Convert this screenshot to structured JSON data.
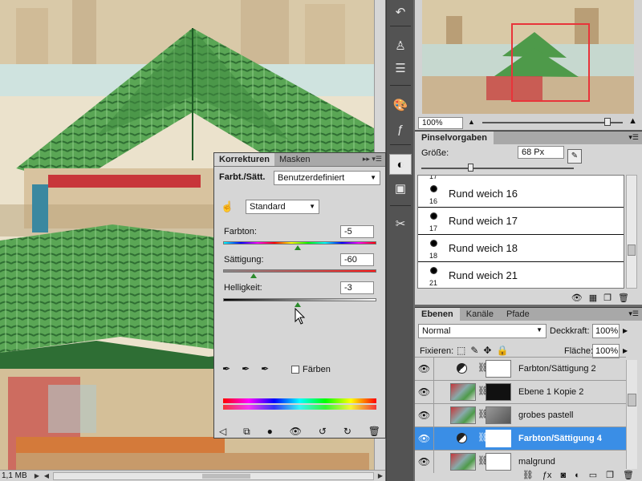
{
  "colors": {
    "accent": "#3a8ee6",
    "roof_green": "#4e9a4a",
    "red_accent": "#c8363a",
    "panel_bg": "#d6d6d6"
  },
  "status_bar": {
    "zoom_value": "1,1 MB"
  },
  "icon_strip": {
    "icons": [
      "history-icon",
      "clone-source-icon",
      "actions-icon",
      "swatches-icon",
      "styles-icon",
      "adjustments-icon",
      "masks-icon",
      "tools-icon"
    ]
  },
  "navigator": {
    "zoom": "100%"
  },
  "brush_presets": {
    "tab": "Pinselvorgaben",
    "size_label": "Größe:",
    "size_value": "68 Px",
    "items": [
      {
        "num": "16",
        "name": "Rund weich 16"
      },
      {
        "num": "17",
        "name": "Rund weich 17"
      },
      {
        "num": "18",
        "name": "Rund weich 18"
      },
      {
        "num": "21",
        "name": "Rund weich 21"
      }
    ],
    "top_number": "17"
  },
  "layers_panel": {
    "tabs": [
      "Ebenen",
      "Kanäle",
      "Pfade"
    ],
    "blend_mode": "Normal",
    "opacity_label": "Deckkraft:",
    "opacity_value": "100%",
    "lock_label": "Fixieren:",
    "fill_label": "Fläche:",
    "fill_value": "100%",
    "layers": [
      {
        "name": "Farbton/Sättigung 2",
        "type": "adjustment",
        "selected": false
      },
      {
        "name": "Ebene 1 Kopie 2",
        "type": "image",
        "selected": false
      },
      {
        "name": "grobes pastell",
        "type": "image",
        "selected": false
      },
      {
        "name": "Farbton/Sättigung 4",
        "type": "adjustment",
        "selected": true
      },
      {
        "name": "malgrund",
        "type": "image",
        "selected": false
      }
    ]
  },
  "adjustments": {
    "tabs": [
      "Korrekturen",
      "Masken"
    ],
    "title": "Farbt./Sätt.",
    "preset": "Benutzerdefiniert",
    "range": "Standard",
    "hue": {
      "label": "Farbton:",
      "value": "-5",
      "level": 0.486
    },
    "saturation": {
      "label": "Sättigung:",
      "value": "-60",
      "level": 0.2
    },
    "lightness": {
      "label": "Helligkeit:",
      "value": "-3",
      "level": 0.485
    },
    "colorize_label": "Färben"
  }
}
